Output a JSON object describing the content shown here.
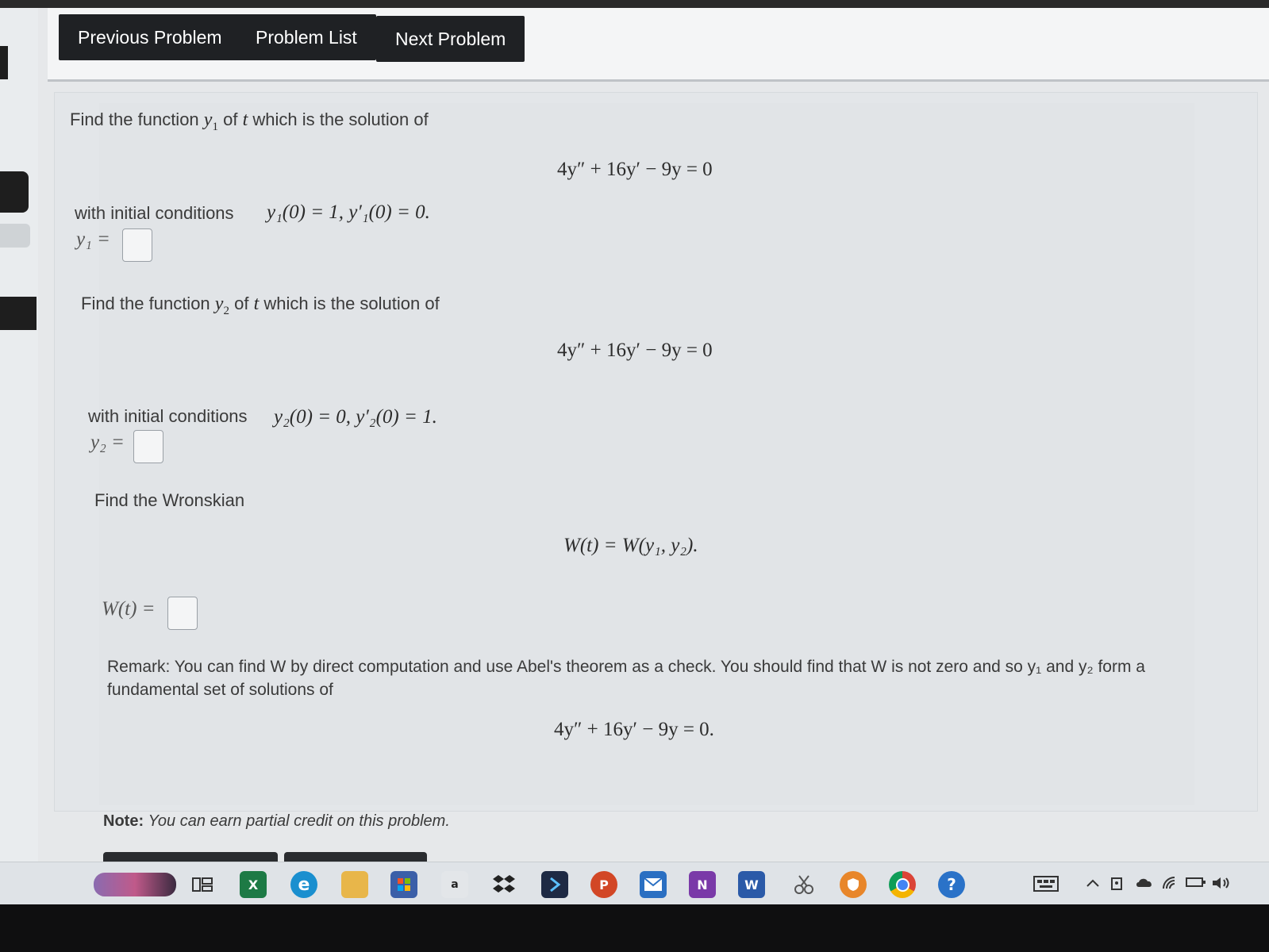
{
  "nav": {
    "previous": "Previous Problem",
    "list": "Problem List",
    "next": "Next Problem"
  },
  "problem": {
    "intro1_a": "Find the function",
    "intro1_var": "y",
    "intro1_sub": "1",
    "intro1_b": "of",
    "intro1_t": "t",
    "intro1_c": "which is the solution of",
    "equation": "4y″ + 16y′ − 9y = 0",
    "init_label": "with initial conditions",
    "init1": "y₁(0) = 1,   y′₁(0) = 0.",
    "answer1_label": "y₁ =",
    "intro2_a": "Find the function",
    "intro2_var": "y",
    "intro2_sub": "2",
    "intro2_b": "of",
    "intro2_t": "t",
    "intro2_c": "which is the solution of",
    "init2": "y₂(0) = 0,   y′₂(0) = 1.",
    "answer2_label": "y₂ =",
    "wronskian_intro": "Find the Wronskian",
    "wronskian_def": "W(t) = W(y₁, y₂).",
    "answer3_label": "W(t) =",
    "remark": "Remark: You can find W by direct computation and use Abel's theorem as a check. You should find that W is not zero and so y₁ and y₂ form a fundamental set of solutions of",
    "final_equation": "4y″ + 16y′ − 9y = 0.",
    "note_label": "Note:",
    "note_text": "You can earn partial credit on this problem."
  },
  "taskbar": {
    "icons": [
      "app-thumbnail-icon",
      "task-view-icon",
      "excel-icon",
      "edge-icon",
      "file-explorer-icon",
      "store-icon",
      "amazon-icon",
      "dropbox-icon",
      "powershell-icon",
      "powerpoint-icon",
      "mail-icon",
      "onenote-icon",
      "word-icon",
      "snipping-tool-icon",
      "vpn-icon",
      "chrome-icon",
      "help-icon"
    ],
    "excel": "X",
    "edge": "e",
    "amazon": "a",
    "powerpoint": "P",
    "onenote": "N",
    "word": "W",
    "help": "?"
  },
  "colors": {
    "nav_button": "#1f2124",
    "panel": "#e3e6e9",
    "taskbar": "#dfe3e7"
  }
}
